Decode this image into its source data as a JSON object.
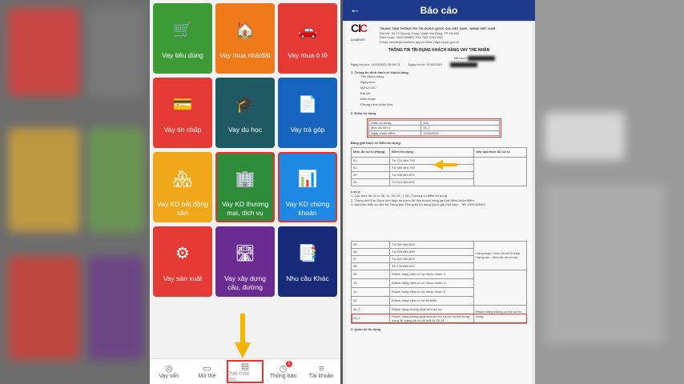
{
  "left_app": {
    "tiles": [
      {
        "label": "Vay tiêu dùng",
        "color": "#3d9b35",
        "icon": "shopping-cart-icon",
        "glyph": "🛒"
      },
      {
        "label": "Vay mua nhà/đất",
        "color": "#ef7a1a",
        "icon": "house-icon",
        "glyph": "🏠"
      },
      {
        "label": "Vay mua ô tô",
        "color": "#e53935",
        "icon": "car-icon",
        "glyph": "🚗"
      },
      {
        "label": "Vay tín chấp",
        "color": "#e53935",
        "icon": "credit-card-icon",
        "glyph": "💳"
      },
      {
        "label": "Vay du học",
        "color": "#1f5a63",
        "icon": "graduation-cap-icon",
        "glyph": "🎓"
      },
      {
        "label": "Vay trả góp",
        "color": "#1565c0",
        "icon": "document-dollar-icon",
        "glyph": "📄"
      },
      {
        "label": "Vay KD bất động sản",
        "color": "#f0a81a",
        "icon": "building-dollar-icon",
        "glyph": "🏘"
      },
      {
        "label": "Vay KD thương mại, dịch vụ",
        "color": "#2e8b3a",
        "icon": "city-icon",
        "glyph": "🏢"
      },
      {
        "label": "Vay KD chứng khoán",
        "color": "#1e88e5",
        "icon": "stock-chart-icon",
        "glyph": "📊"
      },
      {
        "label": "Vay sản xuất",
        "color": "#e53935",
        "icon": "gears-icon",
        "glyph": "⚙"
      },
      {
        "label": "Vay xây dựng cầu, đường",
        "color": "#6a2c91",
        "icon": "road-icon",
        "glyph": "🛣"
      },
      {
        "label": "Nhu cầu Khác",
        "color": "#1a2a7a",
        "icon": "documents-dollar-icon",
        "glyph": "📑"
      }
    ],
    "nav": [
      {
        "label": "Vay vốn",
        "icon": "wallet-icon",
        "glyph": "◎"
      },
      {
        "label": "Mở thẻ",
        "icon": "card-icon",
        "glyph": "▭"
      },
      {
        "label": "Khai thác báo...",
        "icon": "report-icon",
        "glyph": "▤"
      },
      {
        "label": "Thông báo",
        "icon": "bell-icon",
        "glyph": "◷",
        "badge": "1"
      },
      {
        "label": "Tài khoản",
        "icon": "menu-icon",
        "glyph": "≡"
      }
    ],
    "highlight_color": "#e8332d",
    "arrow_color": "#f5b400"
  },
  "report": {
    "header_title": "Báo cáo",
    "back_glyph": "←",
    "logo_text": "CIC",
    "logo_sub": "CreditINFO",
    "org_name": "TRUNG TÂM THÔNG TIN TÍN DỤNG QUỐC GIA VIỆT NAM - NHNN VIỆT NAM",
    "org_lines": [
      "Địa chỉ: Số 10 Quang Trung, Quận Hà Đông, TP Hà Nội",
      "Điện thoại: 1800 585891     Fax: 024 22517861",
      "Email: infohtr@creditinfo.org.vn     Web: https://pcic.gov.vn"
    ],
    "code_label": "Mã vạch:",
    "doc_title": "THÔNG TIN TÍN DỤNG KHÁCH HÀNG VAY THỂ NHÂN",
    "code_row_label": "Mã vạch:",
    "request_date_label": "Ngày tra cứu:",
    "request_date": "11/03/2021 06:06:21",
    "report_date_label": "Ngày trả lời:",
    "report_date": "11/03/2021",
    "sec1_title": "1. Thông tin định danh về khách hàng",
    "sec1_fields": [
      "Tên khách hàng:",
      "Ngày sinh:",
      "Mã số CIC:",
      "Địa chỉ:",
      "Điện thoại:",
      "Chứng minh nhân dân:"
    ],
    "sec2_title": "2. Điểm tín dụng",
    "score_rows": [
      {
        "k": "Điểm tín dụng:",
        "v": "N/A"
      },
      {
        "k": "Mức độ rủi ro:",
        "v": "05_T"
      },
      {
        "k": "Ngày chấm điểm:",
        "v": "11/03/2021"
      }
    ],
    "legend_title": "Bảng giải thích về điểm tín dụng:",
    "table_head": [
      "Mức độ rủi ro (Hạng)",
      "Điểm tín dụng",
      "Xếp loại mức độ rủi ro"
    ],
    "table_top_rows": [
      [
        "01",
        "Từ 710 đến 753"
      ],
      [
        "02",
        "Từ 680 đến 709"
      ],
      [
        "03",
        "Từ 635 đến 679"
      ],
      [
        "04",
        "Từ 510 đến 634"
      ]
    ],
    "notes_title": "Lưu ý:",
    "notes": [
      "1. Các mức độ rủi ro 06, 11, 16, 04_T, 05_T không có điểm tín dụng.",
      "2. Thông tin rủi ro được tính toán dựa trên dữ liệu khách hàng tại thời điểm chấm điểm.",
      "3. Mọi thắc mắc xin liên hệ Trung tâm Thông tin tín dụng Quốc gia Việt Nam - Tel: 1800 585891"
    ],
    "table_bottom_rows": [
      [
        "05",
        "Từ 560 đến 609"
      ],
      [
        "06",
        "Từ 530 đến 559"
      ],
      [
        "07",
        "Từ 420 đến 519"
      ],
      [
        "08",
        "Từ 176 đến 419"
      ],
      [
        "09",
        "Khách hàng hiện có nợ thuộc nhóm 3"
      ],
      [
        "10",
        "Khách hàng hiện có nợ thuộc nhóm 4"
      ],
      [
        "11",
        "Khách hàng hiện có nợ thuộc nhóm 5"
      ],
      [
        "00",
        "Khách hàng hiện có nợ tối thiểu"
      ],
      [
        "04_T",
        "Khách hàng không phát sinh dư nợ"
      ],
      [
        "05_T",
        "Khách hàng không phát sinh dư nợ và dư nợ thẻ trong vòng 36 tháng và có độ tuổi từ 18-34"
      ]
    ],
    "group_label_1": "Hạng thấp - Mức độ rủi ro thấp",
    "group_label_2": "Hạng cao - Mức độ rủi ro cao",
    "group_label_3": "Khách hàng không có lịch sử tín dụng",
    "sec3_title": "3. Quan hệ tín dụng"
  }
}
